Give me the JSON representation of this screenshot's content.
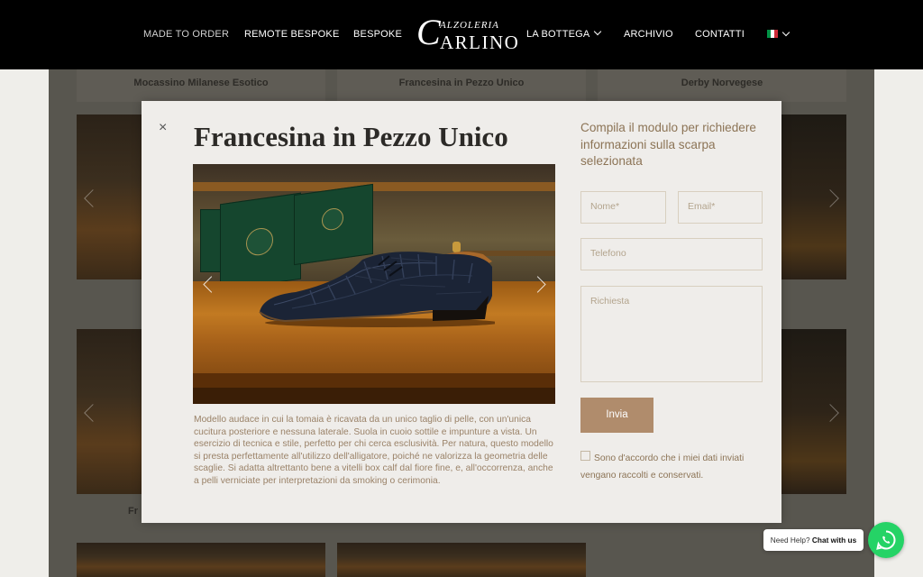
{
  "header": {
    "nav_left": [
      "MADE TO ORDER",
      "REMOTE BESPOKE",
      "BESPOKE"
    ],
    "logo": {
      "initial": "C",
      "top": "ALZOLERIA",
      "bottom": "ARLINO"
    },
    "nav_right": [
      "LA BOTTEGA",
      "ARCHIVIO",
      "CONTATTI"
    ],
    "language_flag": "italian-flag-icon"
  },
  "background": {
    "products": [
      "Mocassino Milanese Esotico",
      "Francesina in Pezzo Unico",
      "Derby Norvegese"
    ],
    "partial_label": "Fr"
  },
  "modal": {
    "close": "×",
    "title": "Francesina in Pezzo Unico",
    "description": "Modello audace in cui la tomaia è ricavata da un unico taglio di pelle, con un'unica cucitura posteriore e nessuna laterale. Suola in cuoio sottile e impunture a vista. Un esercizio di tecnica e stile, perfetto per chi cerca esclusività. Per natura, questo modello si presta perfettamente all'utilizzo dell'alligatore, poiché ne valorizza la geometria delle scaglie. Si adatta altrettanto bene a vitelli box calf dal fiore fine, e, all'occorrenza, anche a pelli verniciate per interpretazioni da smoking o cerimonia.",
    "form": {
      "heading": "Compila il modulo per richiedere informazioni sulla scarpa selezionata",
      "name_placeholder": "Nome*",
      "email_placeholder": "Email*",
      "phone_placeholder": "Telefono",
      "message_placeholder": "Richiesta",
      "submit_label": "Invia",
      "consent_label": "Sono d'accordo che i miei dati inviati vengano raccolti e conservati."
    }
  },
  "whatsapp": {
    "help_text": "Need Help?",
    "chat_text": "Chat with us"
  },
  "colors": {
    "accent": "#b08c6c",
    "header": "#000000",
    "whatsapp": "#25d366"
  }
}
